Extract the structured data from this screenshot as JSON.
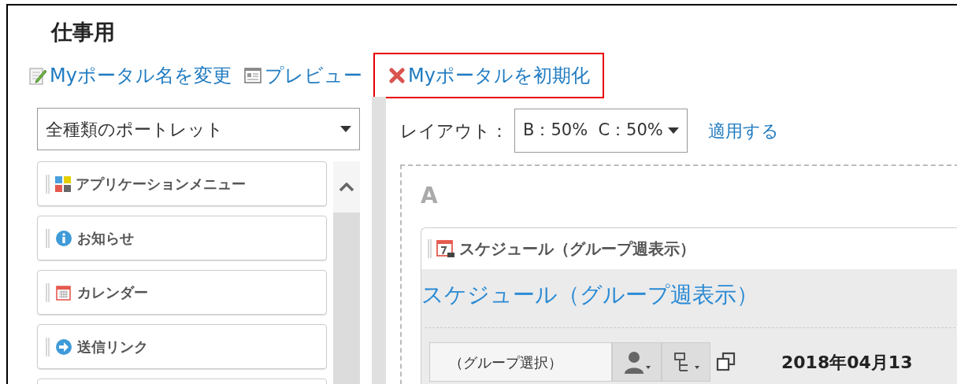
{
  "page_title": "仕事用",
  "actions": [
    {
      "kind": "edit",
      "label": "Myポータル名を変更",
      "highlighted": false
    },
    {
      "kind": "preview",
      "label": "プレビュー",
      "highlighted": false
    },
    {
      "kind": "reset",
      "label": "Myポータルを初期化",
      "highlighted": true
    }
  ],
  "portlet_filter": {
    "value": "全種類のポートレット"
  },
  "portlets": [
    {
      "kind": "apps",
      "label": "アプリケーションメニュー"
    },
    {
      "kind": "info",
      "label": "お知らせ"
    },
    {
      "kind": "calendar",
      "label": "カレンダー"
    },
    {
      "kind": "link",
      "label": "送信リンク"
    }
  ],
  "layout": {
    "label": "レイアウト：",
    "value": "B：50%  C：50%",
    "apply": "適用する"
  },
  "area": {
    "label": "A",
    "portlet": {
      "header": "スケジュール（グループ週表示）",
      "title": "スケジュール（グループ週表示）",
      "group_select": "（グループ選択）",
      "date": "2018年04月13"
    }
  }
}
